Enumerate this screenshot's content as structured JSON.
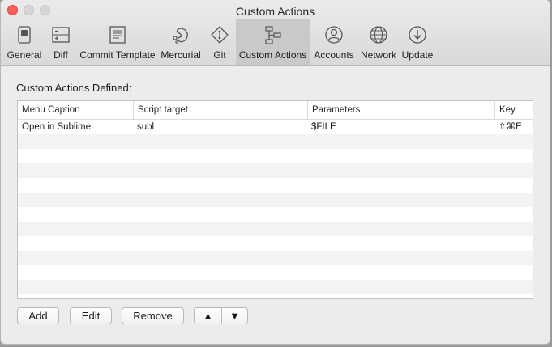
{
  "window": {
    "title": "Custom Actions"
  },
  "toolbar": {
    "items": [
      {
        "label": "General",
        "icon": "general-icon"
      },
      {
        "label": "Diff",
        "icon": "diff-icon"
      },
      {
        "label": "Commit Template",
        "icon": "commit-template-icon"
      },
      {
        "label": "Mercurial",
        "icon": "mercurial-icon"
      },
      {
        "label": "Git",
        "icon": "git-icon"
      },
      {
        "label": "Custom Actions",
        "icon": "custom-actions-icon",
        "active": true
      },
      {
        "label": "Accounts",
        "icon": "accounts-icon"
      },
      {
        "label": "Network",
        "icon": "network-icon"
      },
      {
        "label": "Update",
        "icon": "update-icon"
      }
    ]
  },
  "main": {
    "section_label": "Custom Actions Defined:",
    "table": {
      "columns": [
        "Menu Caption",
        "Script target",
        "Parameters",
        "Key"
      ],
      "rows": [
        {
          "caption": "Open in Sublime",
          "script": "subl",
          "parameters": "$FILE",
          "key": "⇧⌘E"
        }
      ]
    }
  },
  "buttons": {
    "add": "Add",
    "edit": "Edit",
    "remove": "Remove",
    "move_up": "▲",
    "move_down": "▼"
  },
  "colors": {
    "active_tab_bg": "#c9c9c9",
    "close": "#fc5f57"
  }
}
